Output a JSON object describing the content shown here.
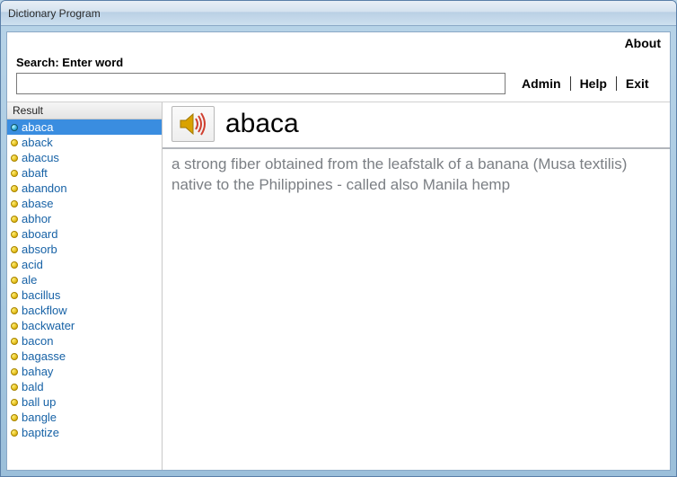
{
  "window": {
    "title": "Dictionary Program"
  },
  "header": {
    "about": "About",
    "search_label": "Search: Enter word",
    "search_value": "",
    "admin": "Admin",
    "help": "Help",
    "exit": "Exit"
  },
  "sidebar": {
    "header": "Result",
    "selected_index": 0,
    "items": [
      "abaca",
      "aback",
      "abacus",
      "abaft",
      "abandon",
      "abase",
      "abhor",
      "aboard",
      "absorb",
      "acid",
      "ale",
      "bacillus",
      "backflow",
      "backwater",
      "bacon",
      "bagasse",
      "bahay",
      "bald",
      "ball up",
      "bangle",
      "baptize"
    ]
  },
  "detail": {
    "word": "abaca",
    "definition": "a strong fiber obtained from the leafstalk of a banana (Musa textilis) native to the Philippines - called also Manila hemp",
    "speaker_icon": "speaker-icon"
  }
}
